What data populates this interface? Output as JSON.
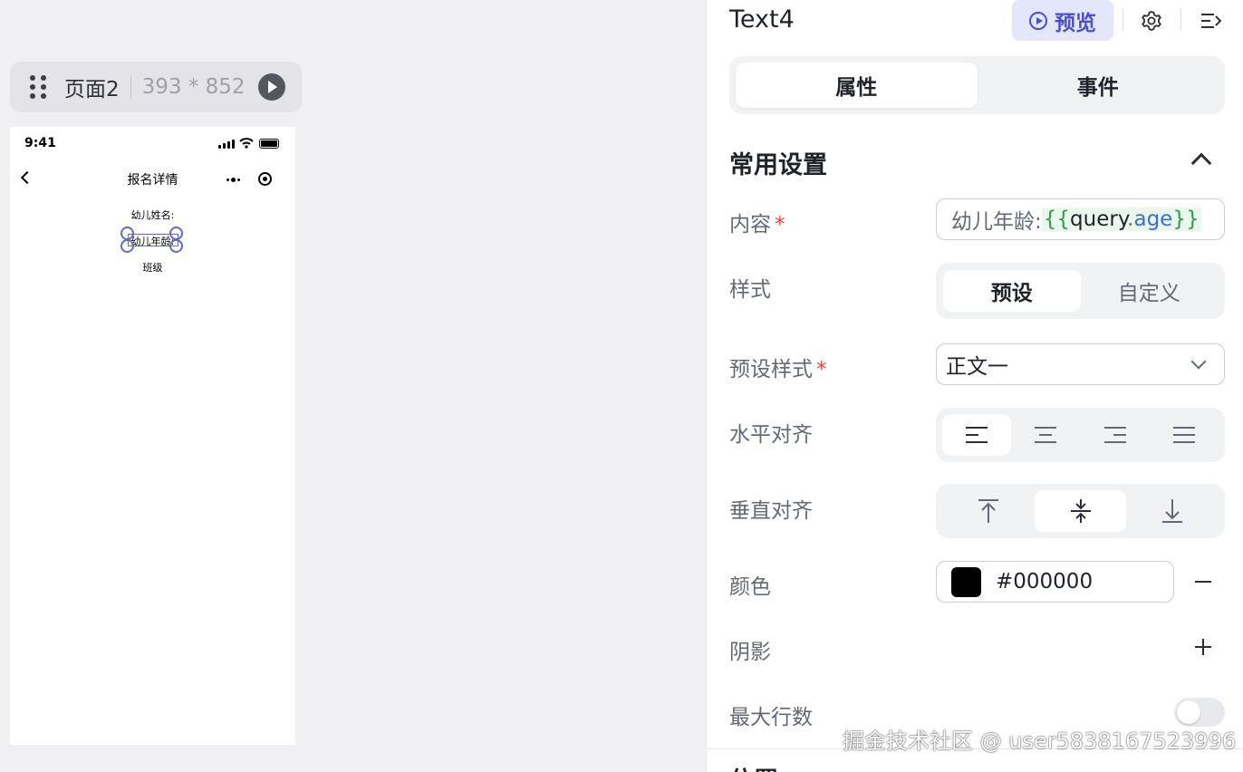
{
  "canvas": {
    "page_name": "页面2",
    "page_size": "393 * 852"
  },
  "phone": {
    "status_time": "9:41",
    "nav_title": "报名详情",
    "lines": [
      "幼儿姓名:",
      "幼儿年龄:",
      "班级"
    ]
  },
  "panel": {
    "component_name": "Text4",
    "preview_label": "预览",
    "tabs": [
      {
        "label": "属性",
        "active": true
      },
      {
        "label": "事件",
        "active": false
      }
    ],
    "section_title": "常用设置",
    "content": {
      "label": "内容",
      "required_mark": "*",
      "text": "幼儿年龄:",
      "expr_open": "{{",
      "expr_obj": "query",
      "expr_dot": ".",
      "expr_prop": "age",
      "expr_close": "}}"
    },
    "style": {
      "label": "样式",
      "options": [
        "预设",
        "自定义"
      ],
      "selected": "预设"
    },
    "preset_style": {
      "label": "预设样式",
      "required_mark": "*",
      "value": "正文一"
    },
    "h_align": {
      "label": "水平对齐",
      "icons": [
        "align-left-icon",
        "align-center-icon",
        "align-right-icon",
        "align-justify-icon"
      ],
      "selected": "align-left-icon"
    },
    "v_align": {
      "label": "垂直对齐",
      "icons": [
        "align-top-icon",
        "align-middle-icon",
        "align-bottom-icon"
      ],
      "selected": "align-middle-icon"
    },
    "color": {
      "label": "颜色",
      "value": "#000000"
    },
    "shadow": {
      "label": "阴影"
    },
    "max_lines": {
      "label": "最大行数",
      "enabled": false
    },
    "next_section_title": "位置"
  },
  "watermark": "掘金技术社区 @ user5838167523996",
  "colors": {
    "accent": "#4a4fd9",
    "selection": "#6366d6",
    "required": "#e5483f"
  }
}
